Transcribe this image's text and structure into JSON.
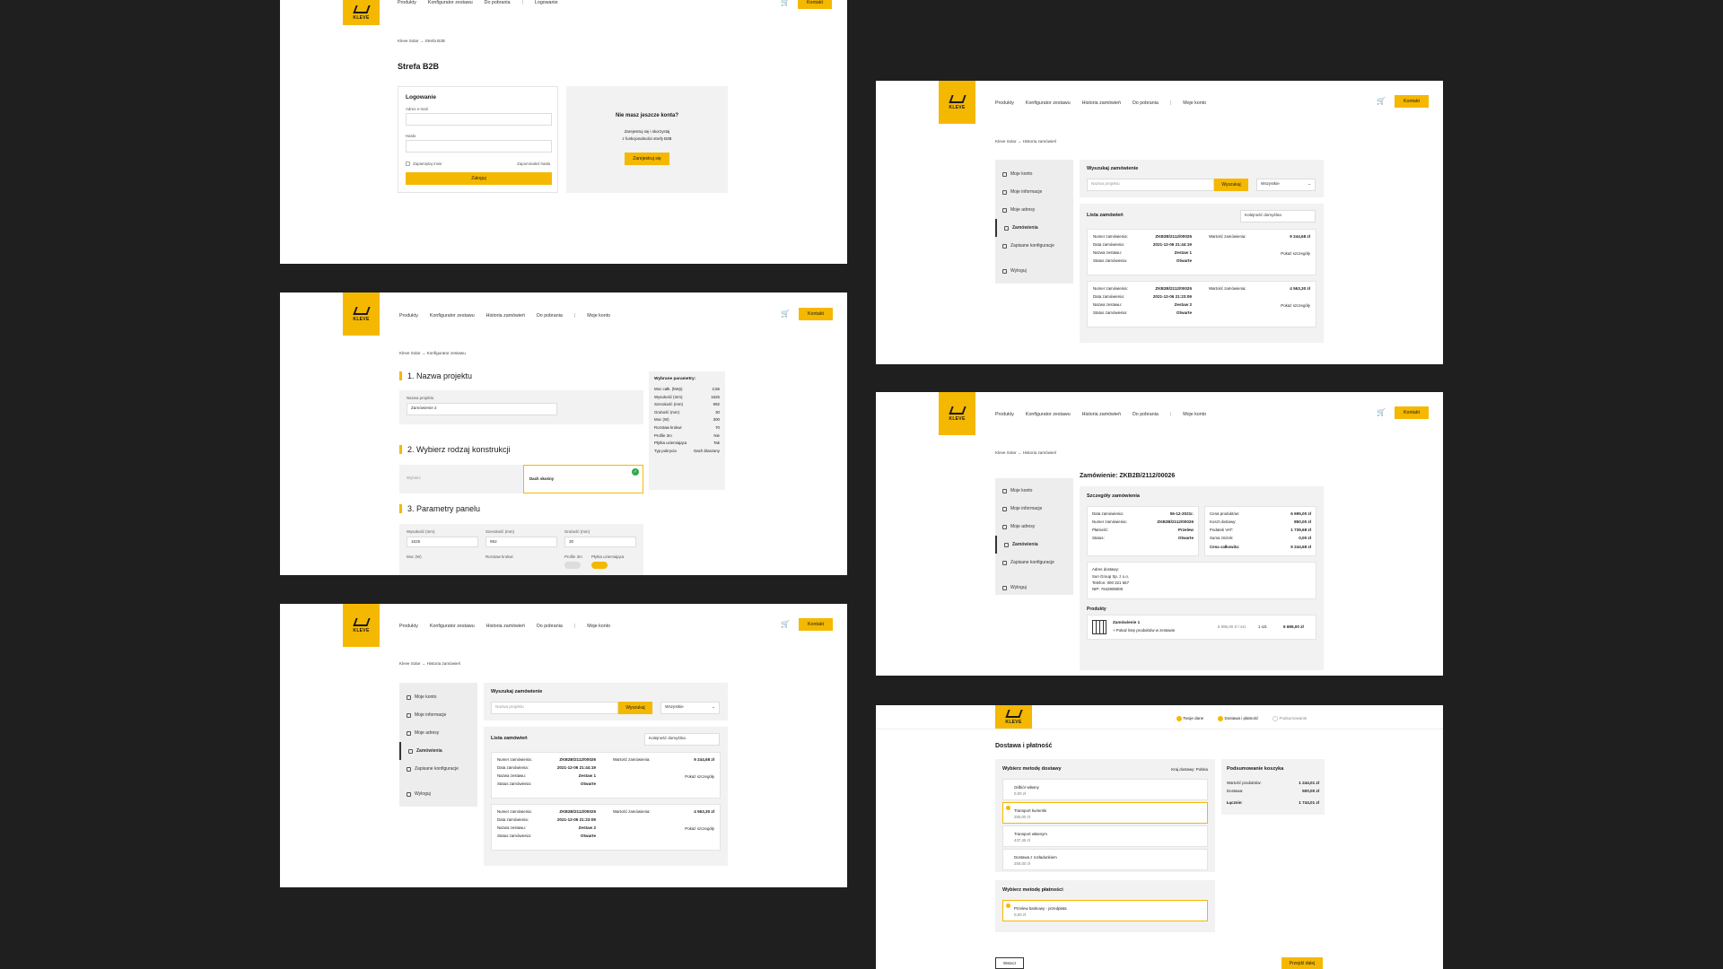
{
  "brand": {
    "logo_text": "KLEVE",
    "accent": "#f5b800"
  },
  "nav": {
    "products": "Produkty",
    "configurator": "Konfigurator zestawu",
    "history": "Historia zamówień",
    "downloads": "Do pobrania",
    "login": "Logowanie",
    "my_account": "Moje konto",
    "contact": "Kontakt"
  },
  "login_screen": {
    "breadcrumb": "Kleve Solar → Strefa B2B",
    "page_title": "Strefa B2B",
    "form_title": "Logowanie",
    "email_label": "Adres e-mail",
    "password_label": "Hasło",
    "remember_label": "Zapamiętaj mnie",
    "forgot_label": "Zapomniałeś hasła",
    "submit_label": "Zaloguj",
    "promo_title": "Nie masz jeszcze konta?",
    "promo_text_1": "Zarejestruj się i skorzystaj",
    "promo_text_2": "z funkcjonalności strefy B2B",
    "register_label": "Zarejestruj się"
  },
  "config_screen": {
    "breadcrumb": "Kleve Solar → Konfigurator zestawu",
    "s1_title": "1. Nazwa projektu",
    "project_label": "Nazwa projektu",
    "project_value": "Zamówienie 2",
    "s2_title": "2. Wybierz rodzaj konstrukcji",
    "construction_a": "Wybierz",
    "construction_b": "Dach skośny",
    "s3_title": "3. Parametry panelu",
    "height_label": "Wysokość (mm)",
    "height_value": "1625",
    "width_label": "Szerokość (mm)",
    "width_value": "992",
    "thickness_label": "Grubość (mm)",
    "thickness_value": "30",
    "power_label": "Moc (W)",
    "spacing_label": "Rozstaw krokwi",
    "profile_label": "Profile 3m",
    "plate_label": "Płytka uziemiająca",
    "params_title": "Wybrane parametry:",
    "params": [
      {
        "k": "Moc całk. (kWp)",
        "v": "2,56"
      },
      {
        "k": "Wysokość (mm)",
        "v": "1625"
      },
      {
        "k": "Szerokość (mm)",
        "v": "992"
      },
      {
        "k": "Grubość (mm)",
        "v": "30"
      },
      {
        "k": "Moc (W)",
        "v": "300"
      },
      {
        "k": "Rozstaw krokwi",
        "v": "70"
      },
      {
        "k": "Profile 3m",
        "v": "Nie"
      },
      {
        "k": "Płytka uziemiająca",
        "v": "Tak"
      },
      {
        "k": "Typ pokrycia",
        "v": "Dach blaszany"
      }
    ]
  },
  "account": {
    "breadcrumb": "Kleve Solar → Historia zamówień",
    "side": [
      "Moje konto",
      "Moje informacje",
      "Moje adresy",
      "Zamówienia",
      "Zapisane konfiguracje",
      "Wyloguj"
    ],
    "search_title": "Wyszukaj zamówienie",
    "search_placeholder": "Nazwa projektu",
    "search_button": "Wyszukaj",
    "filter_value": "Wszystkie",
    "list_title": "Lista zamówień",
    "sort_value": "Kolejność domyślna",
    "orders": [
      {
        "num": "ZKB2B/2112/00026",
        "date": "2021-12-06 21:44:19",
        "name": "Zestaw 1",
        "status": "Otwarte",
        "value": "9 244,68 zł"
      },
      {
        "num": "ZKB2B/2112/00025",
        "date": "2021-12-06 21:23:09",
        "name": "Zestaw 2",
        "status": "Otwarte",
        "value": "4 563,30 zł"
      }
    ],
    "lbl_num": "Numer zamówienia:",
    "lbl_date": "Data zamówienia:",
    "lbl_name": "Nazwa zestawu:",
    "lbl_status": "Status zamówienia:",
    "lbl_value": "Wartość zamówienia:",
    "details_link": "Pokaż szczegóły"
  },
  "order_detail": {
    "breadcrumb": "Kleve Solar → Historia zamówień",
    "title": "Zamówienie: ZKB2B/2112/00026",
    "details_title": "Szczegóły zamówienia",
    "left": [
      {
        "k": "Data zamówienia:",
        "v": "06-12-2021r."
      },
      {
        "k": "Numer zamówienia:",
        "v": "ZKB2B/2112/00026"
      },
      {
        "k": "Płatność:",
        "v": "Przelew"
      },
      {
        "k": "Status:",
        "v": "Otwarte"
      }
    ],
    "right": [
      {
        "k": "Cena produktów:",
        "v": "6 695,00 zł"
      },
      {
        "k": "Koszt dostawy:",
        "v": "850,00 zł"
      },
      {
        "k": "Podatek VAT:",
        "v": "1 739,68 zł"
      },
      {
        "k": "Suma zniżek:",
        "v": "0,00 zł"
      }
    ],
    "total_label": "Cena całkowita:",
    "total_value": "9 244,68 zł",
    "address_title": "Adres dostawy:",
    "address_1": "Sun Group Sp. z o.o.",
    "address_2": "Telefon: 000 321 567",
    "address_3": "NIP: 7642909000",
    "products_title": "Produkty",
    "product_name": "Zamówienie 1",
    "product_sub": "+ Pokaż listę produktów w zestawie",
    "product_price": "6 695,00 zł / szt.",
    "product_qty": "1 szt.",
    "product_total": "6 695,00 zł"
  },
  "checkout": {
    "steps": [
      "Twoje dane",
      "Dostawa i płatność",
      "Podsumowanie"
    ],
    "title": "Dostawa i płatność",
    "delivery_title": "Wybierz metodę dostawy",
    "country_label": "Kraj dostawy: Polska",
    "delivery": [
      {
        "name": "Odbiór własny",
        "price": "0,00 zł"
      },
      {
        "name": "Transport kurierski",
        "price": "250,00 zł"
      },
      {
        "name": "Transport własnym",
        "price": "437,45 zł"
      },
      {
        "name": "Dostawa z rozładunkiem",
        "price": "250,00 zł"
      }
    ],
    "payment_title": "Wybierz metodę płatności",
    "payment_name": "Przelew bankowy - przedpłata",
    "payment_price": "0,00 zł",
    "summary_title": "Podsumowanie koszyka",
    "sum_products_label": "Wartość produktów:",
    "sum_products_value": "1 244,01 zł",
    "sum_delivery_label": "Dostawa:",
    "sum_delivery_value": "500,00 zł",
    "sum_total_label": "Łącznie:",
    "sum_total_value": "1 744,01 zł",
    "back_label": "Wstecz",
    "next_label": "Przejdź dalej"
  }
}
